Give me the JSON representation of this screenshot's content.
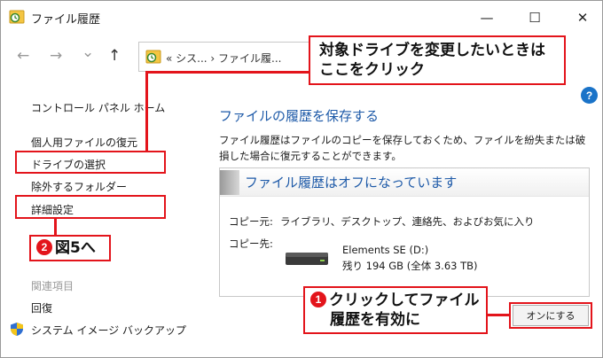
{
  "window": {
    "title": "ファイル履歴",
    "minimize_glyph": "—",
    "maximize_glyph": "☐",
    "close_glyph": "✕"
  },
  "nav": {
    "back_glyph": "←",
    "forward_glyph": "→",
    "recent_glyph": "⌄",
    "up_glyph": "↑",
    "address_path": "« シス... › ファイル履..."
  },
  "left_pane": {
    "items": [
      "コントロール パネル ホーム",
      "個人用ファイルの復元",
      "ドライブの選択",
      "除外するフォルダー",
      "詳細設定"
    ],
    "related_header": "関連項目",
    "related_items": [
      "回復",
      "システム イメージ バックアップ"
    ]
  },
  "main": {
    "help_glyph": "?",
    "heading": "ファイルの履歴を保存する",
    "description": "ファイル履歴はファイルのコピーを保存しておくため、ファイルを紛失または破損した場合に復元することができます。",
    "status_title": "ファイル履歴はオフになっています",
    "copy_from_label": "コピー元:",
    "copy_from_value": "ライブラリ、デスクトップ、連絡先、およびお気に入り",
    "copy_to_label": "コピー先:",
    "drive_name": "Elements SE (D:)",
    "drive_space": "残り 194 GB (全体 3.63 TB)",
    "turn_on_button": "オンにする"
  },
  "annotations": {
    "callout_drive": [
      "対象ドライブを変更したいときは",
      "ここをクリック"
    ],
    "callout_fig_num": "2",
    "callout_fig_text": "図5へ",
    "callout_enable_num": "1",
    "callout_enable": [
      "クリックしてファイル",
      "履歴を有効に"
    ]
  },
  "colors": {
    "accent_blue": "#1e5aa8",
    "annotation_red": "#e3141b"
  }
}
